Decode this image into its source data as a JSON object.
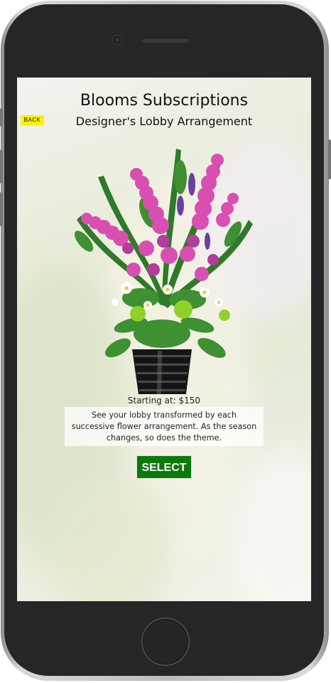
{
  "header": {
    "title": "Blooms Subscriptions",
    "subtitle": "Designer's Lobby Arrangement",
    "back_label": "BACK"
  },
  "product": {
    "image_name": "lobby-flower-arrangement",
    "price_text": "Starting at: $150",
    "description": "See your lobby transformed by each successive flower arrangement. As the season changes, so does the theme.",
    "select_label": "SELECT"
  },
  "colors": {
    "back_button": "#fff200",
    "select_button": "#0b7a0b"
  }
}
